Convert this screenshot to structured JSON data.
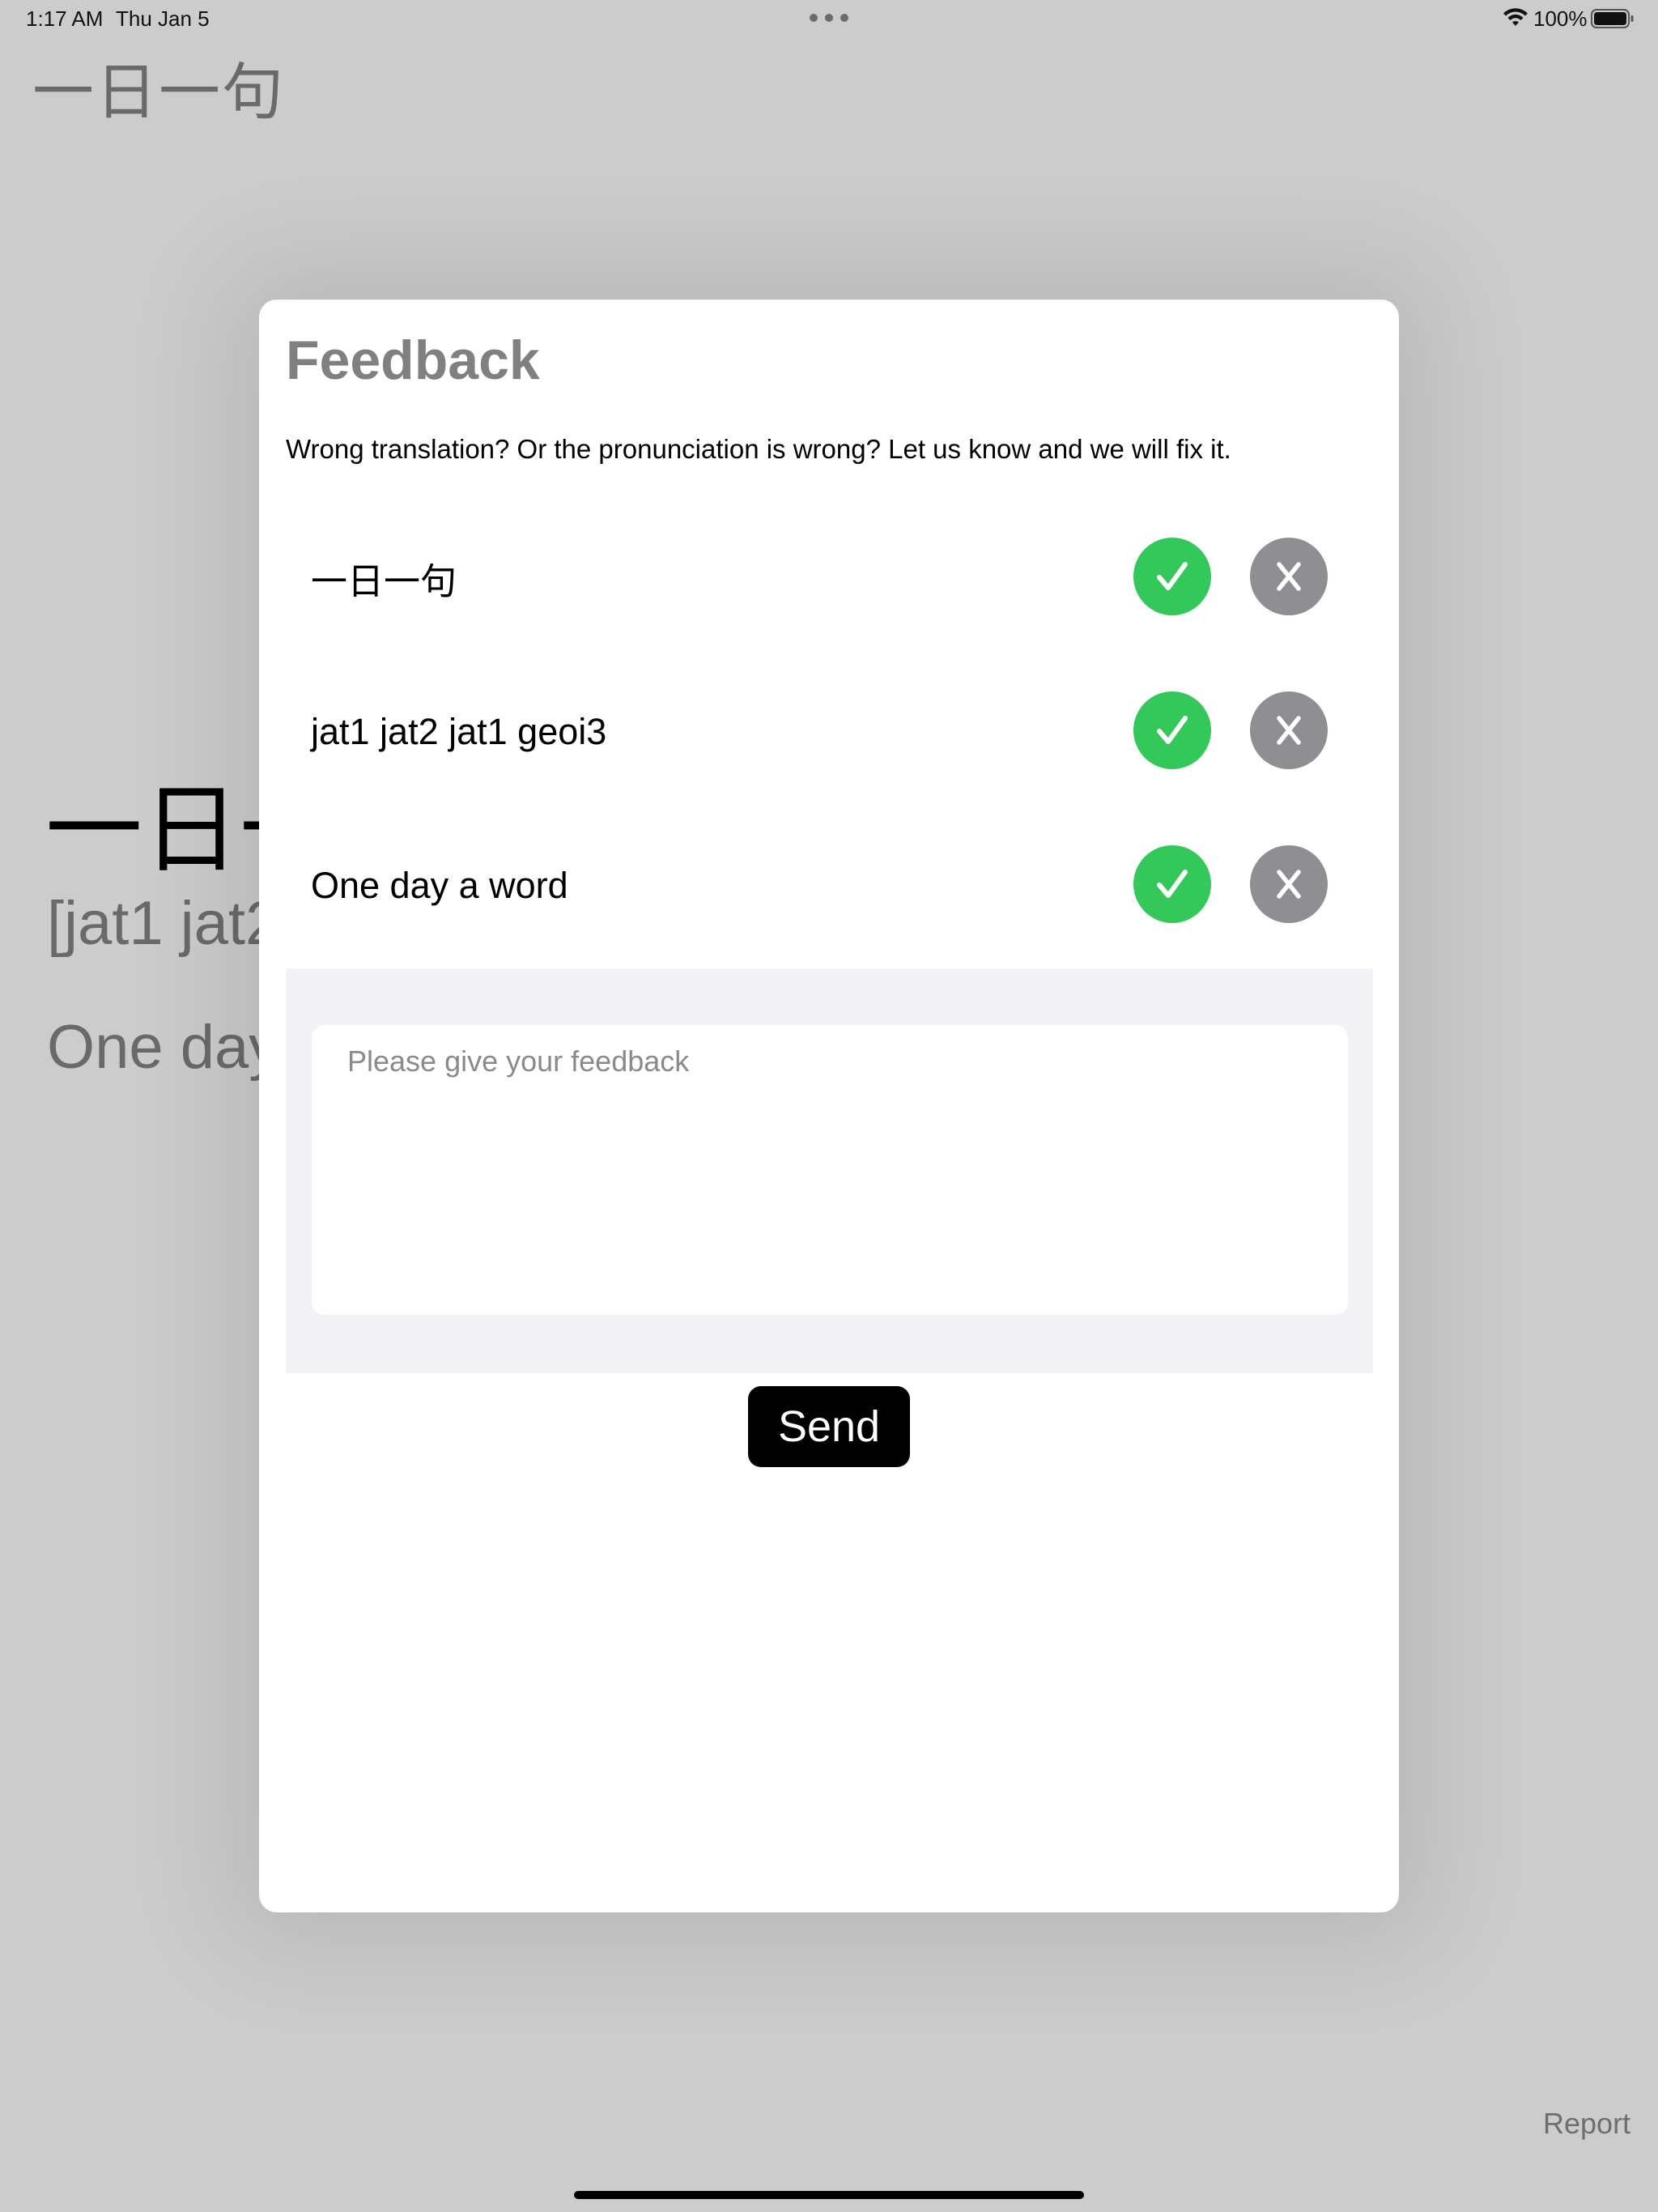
{
  "status_bar": {
    "time": "1:17 AM",
    "date": "Thu Jan 5",
    "battery_percent": "100%",
    "battery_level": 1.0,
    "icons": [
      "multitask-dots-icon",
      "wifi-icon",
      "battery-icon"
    ]
  },
  "background": {
    "app_title": "一日一句",
    "phrase": "一日一",
    "pronunciation": "[jat1 jat2",
    "translation": "One day",
    "report_label": "Report"
  },
  "modal": {
    "title": "Feedback",
    "description": "Wrong translation? Or the pronunciation is wrong? Let us know and we will fix it.",
    "rows": [
      {
        "label": "一日一句",
        "correct_icon": "checkmark-icon",
        "wrong_icon": "x-icon"
      },
      {
        "label": "jat1 jat2 jat1 geoi3",
        "correct_icon": "checkmark-icon",
        "wrong_icon": "x-icon"
      },
      {
        "label": "One day a word",
        "correct_icon": "checkmark-icon",
        "wrong_icon": "x-icon"
      }
    ],
    "feedback_input": {
      "value": "",
      "placeholder": "Please give your feedback"
    },
    "send_label": "Send"
  },
  "colors": {
    "correct": "#34c759",
    "wrong": "#8e8e93",
    "modal_title": "#808080",
    "dim_background": "#cccccc"
  }
}
